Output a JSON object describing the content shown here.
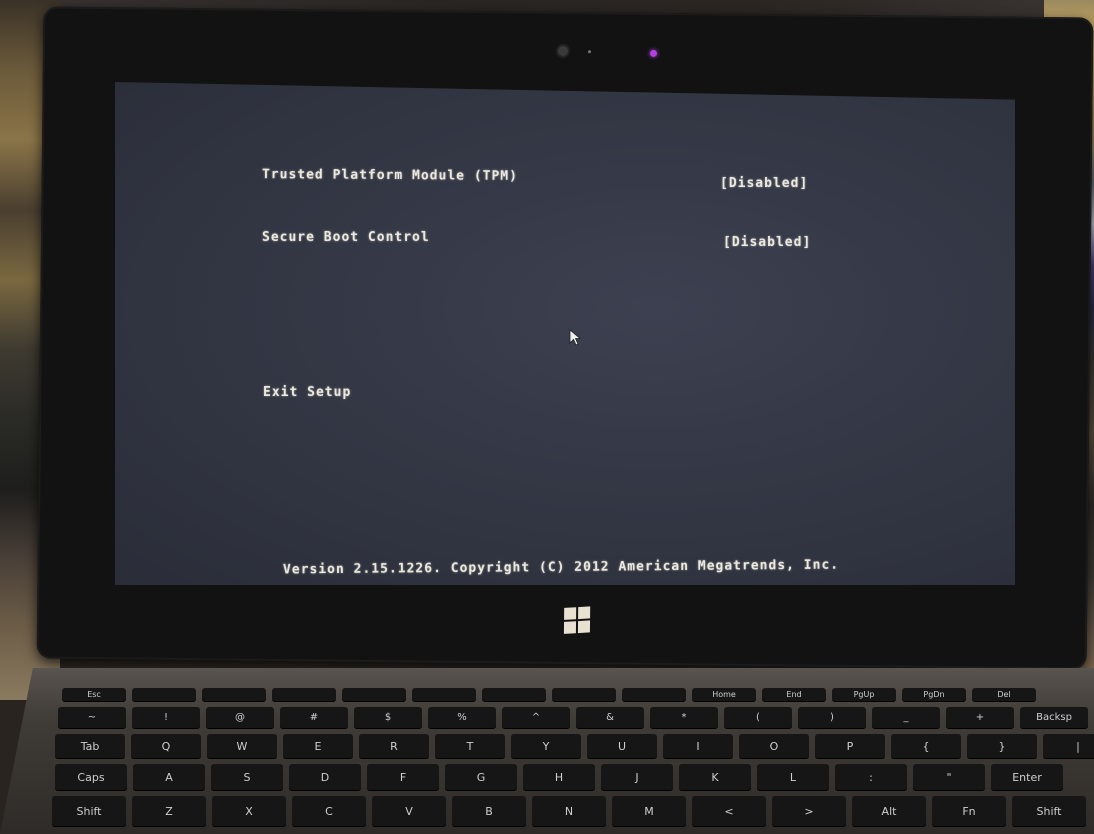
{
  "bios": {
    "settings": [
      {
        "label": "Trusted Platform Module (TPM)",
        "value": "[Disabled]"
      },
      {
        "label": "Secure Boot Control",
        "value": "[Disabled]"
      }
    ],
    "exit_label": "Exit Setup",
    "version_text": "Version 2.15.1226. Copyright (C) 2012 American Megatrends, Inc."
  },
  "device": {
    "led_color": "#b040e0",
    "logo_icon": "windows-logo-icon"
  },
  "keyboard": {
    "function_row": [
      "Esc",
      "",
      "",
      "",
      "",
      "",
      "",
      "",
      "",
      "Home",
      "End",
      "PgUp",
      "PgDn",
      "Del"
    ],
    "number_row": [
      "~",
      "!",
      "@",
      "#",
      "$",
      "%",
      "^",
      "&",
      "*",
      "(",
      ")",
      "_",
      "+",
      "Backsp"
    ],
    "qwerty_row": [
      "Tab",
      "Q",
      "W",
      "E",
      "R",
      "T",
      "Y",
      "U",
      "I",
      "O",
      "P",
      "{",
      "}",
      "|"
    ],
    "home_row": [
      "Caps",
      "A",
      "S",
      "D",
      "F",
      "G",
      "H",
      "J",
      "K",
      "L",
      ":",
      "\"",
      "Enter"
    ],
    "bottom_row": [
      "Shift",
      "Z",
      "X",
      "C",
      "V",
      "B",
      "N",
      "M",
      "<",
      ">",
      "Alt",
      "Fn",
      "Shift"
    ]
  }
}
